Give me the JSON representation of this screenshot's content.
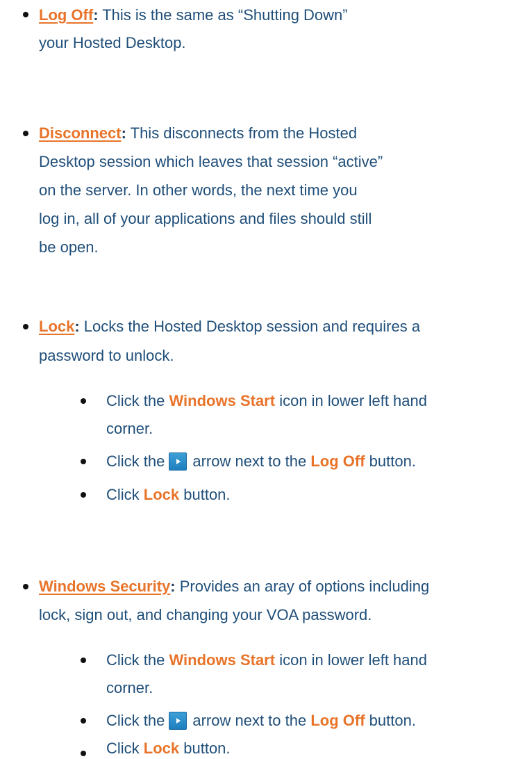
{
  "log_off": {
    "term": "Log Off",
    "colon": ":",
    "line1": " This is the same as “Shutting Down”",
    "line2": "your Hosted Desktop."
  },
  "disconnect": {
    "term": "Disconnect",
    "colon": ":",
    "line1": " This disconnects from the Hosted",
    "line2": "Desktop session which leaves that session “active”",
    "line3": "on the server. In other words, the next time you",
    "line4": "log in, all of your applications and files should still",
    "line5": "be open."
  },
  "lock": {
    "term": "Lock",
    "colon": ":",
    "line1": " Locks the Hosted Desktop session and requires a",
    "line2": "password to unlock.",
    "steps": {
      "s1_pre": "Click the ",
      "s1_hl": "Windows Start",
      "s1_post": " icon in lower left hand",
      "s1_line2": "corner.",
      "s2_pre": "Click the",
      "s2_post": "arrow next to the ",
      "s2_hl": "Log Off",
      "s2_end": " button.",
      "s3_pre": "Click ",
      "s3_hl": "Lock",
      "s3_post": " button."
    }
  },
  "windows_security": {
    "term": "Windows Security",
    "colon": ":",
    "line1": " Provides an aray of options including",
    "line2": "lock, sign out, and changing your VOA password.",
    "steps": {
      "s1_pre": "Click the ",
      "s1_hl": "Windows Start",
      "s1_post": " icon in lower left hand",
      "s1_line2": "corner.",
      "s2_pre": "Click the",
      "s2_post": "arrow next to the ",
      "s2_hl": "Log Off",
      "s2_end": " button.",
      "s3_pre": "Click ",
      "s3_hl": "Lock",
      "s3_post": " button."
    }
  }
}
